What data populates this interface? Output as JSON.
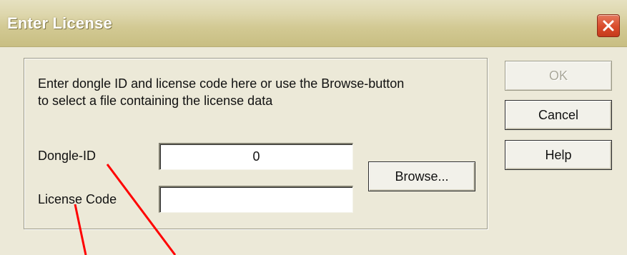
{
  "window": {
    "title": "Enter License"
  },
  "instructions": {
    "line1": "Enter dongle ID and license code here or use the Browse-button",
    "line2": "to select a file containing the license data"
  },
  "fields": {
    "dongle_id_label": "Dongle-ID",
    "dongle_id_value": "0",
    "license_code_label": "License Code",
    "license_code_value": ""
  },
  "buttons": {
    "browse": "Browse...",
    "ok": "OK",
    "cancel": "Cancel",
    "help": "Help"
  },
  "colors": {
    "annotation_lines": "#ff0000",
    "close_button": "#d94b2b"
  },
  "icons": {
    "close": "close-icon"
  }
}
